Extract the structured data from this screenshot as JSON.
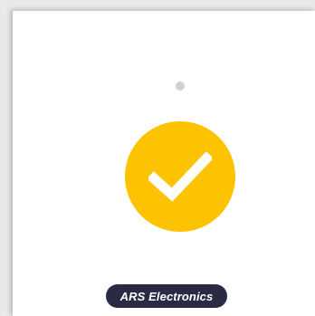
{
  "screen": {
    "status_icon": "checkmark-icon",
    "status_color": "#FDC300",
    "check_color": "#ffffff"
  },
  "footer": {
    "brand_label": "ARS Electronics",
    "brand_bg": "#2a2a45"
  }
}
